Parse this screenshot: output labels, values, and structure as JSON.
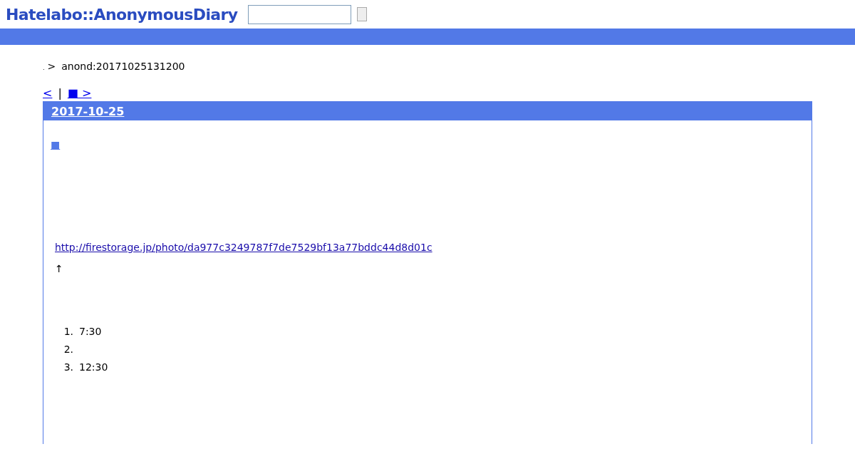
{
  "header": {
    "logo": "Hatelabo::AnonymousDiary"
  },
  "breadcrumb": [
    {
      "label": "."
    },
    {
      "label": ">"
    },
    {
      "label": "anond:20171025131200"
    }
  ],
  "pager": [
    {
      "label": "<",
      "kind": "link"
    },
    {
      "label": "|",
      "kind": "sep"
    },
    {
      "label": "■ >",
      "kind": "link"
    }
  ],
  "entry": {
    "date": "2017-10-25",
    "section_mark": "■",
    "link": "http://firestorage.jp/photo/da977c3249787f7de7529bf13a77bddc44d8d01c",
    "note": "↑",
    "list": [
      {
        "number": "1.",
        "text": "7:30"
      },
      {
        "number": "2."
      },
      {
        "number": "3.",
        "text": "12:30"
      }
    ]
  }
}
